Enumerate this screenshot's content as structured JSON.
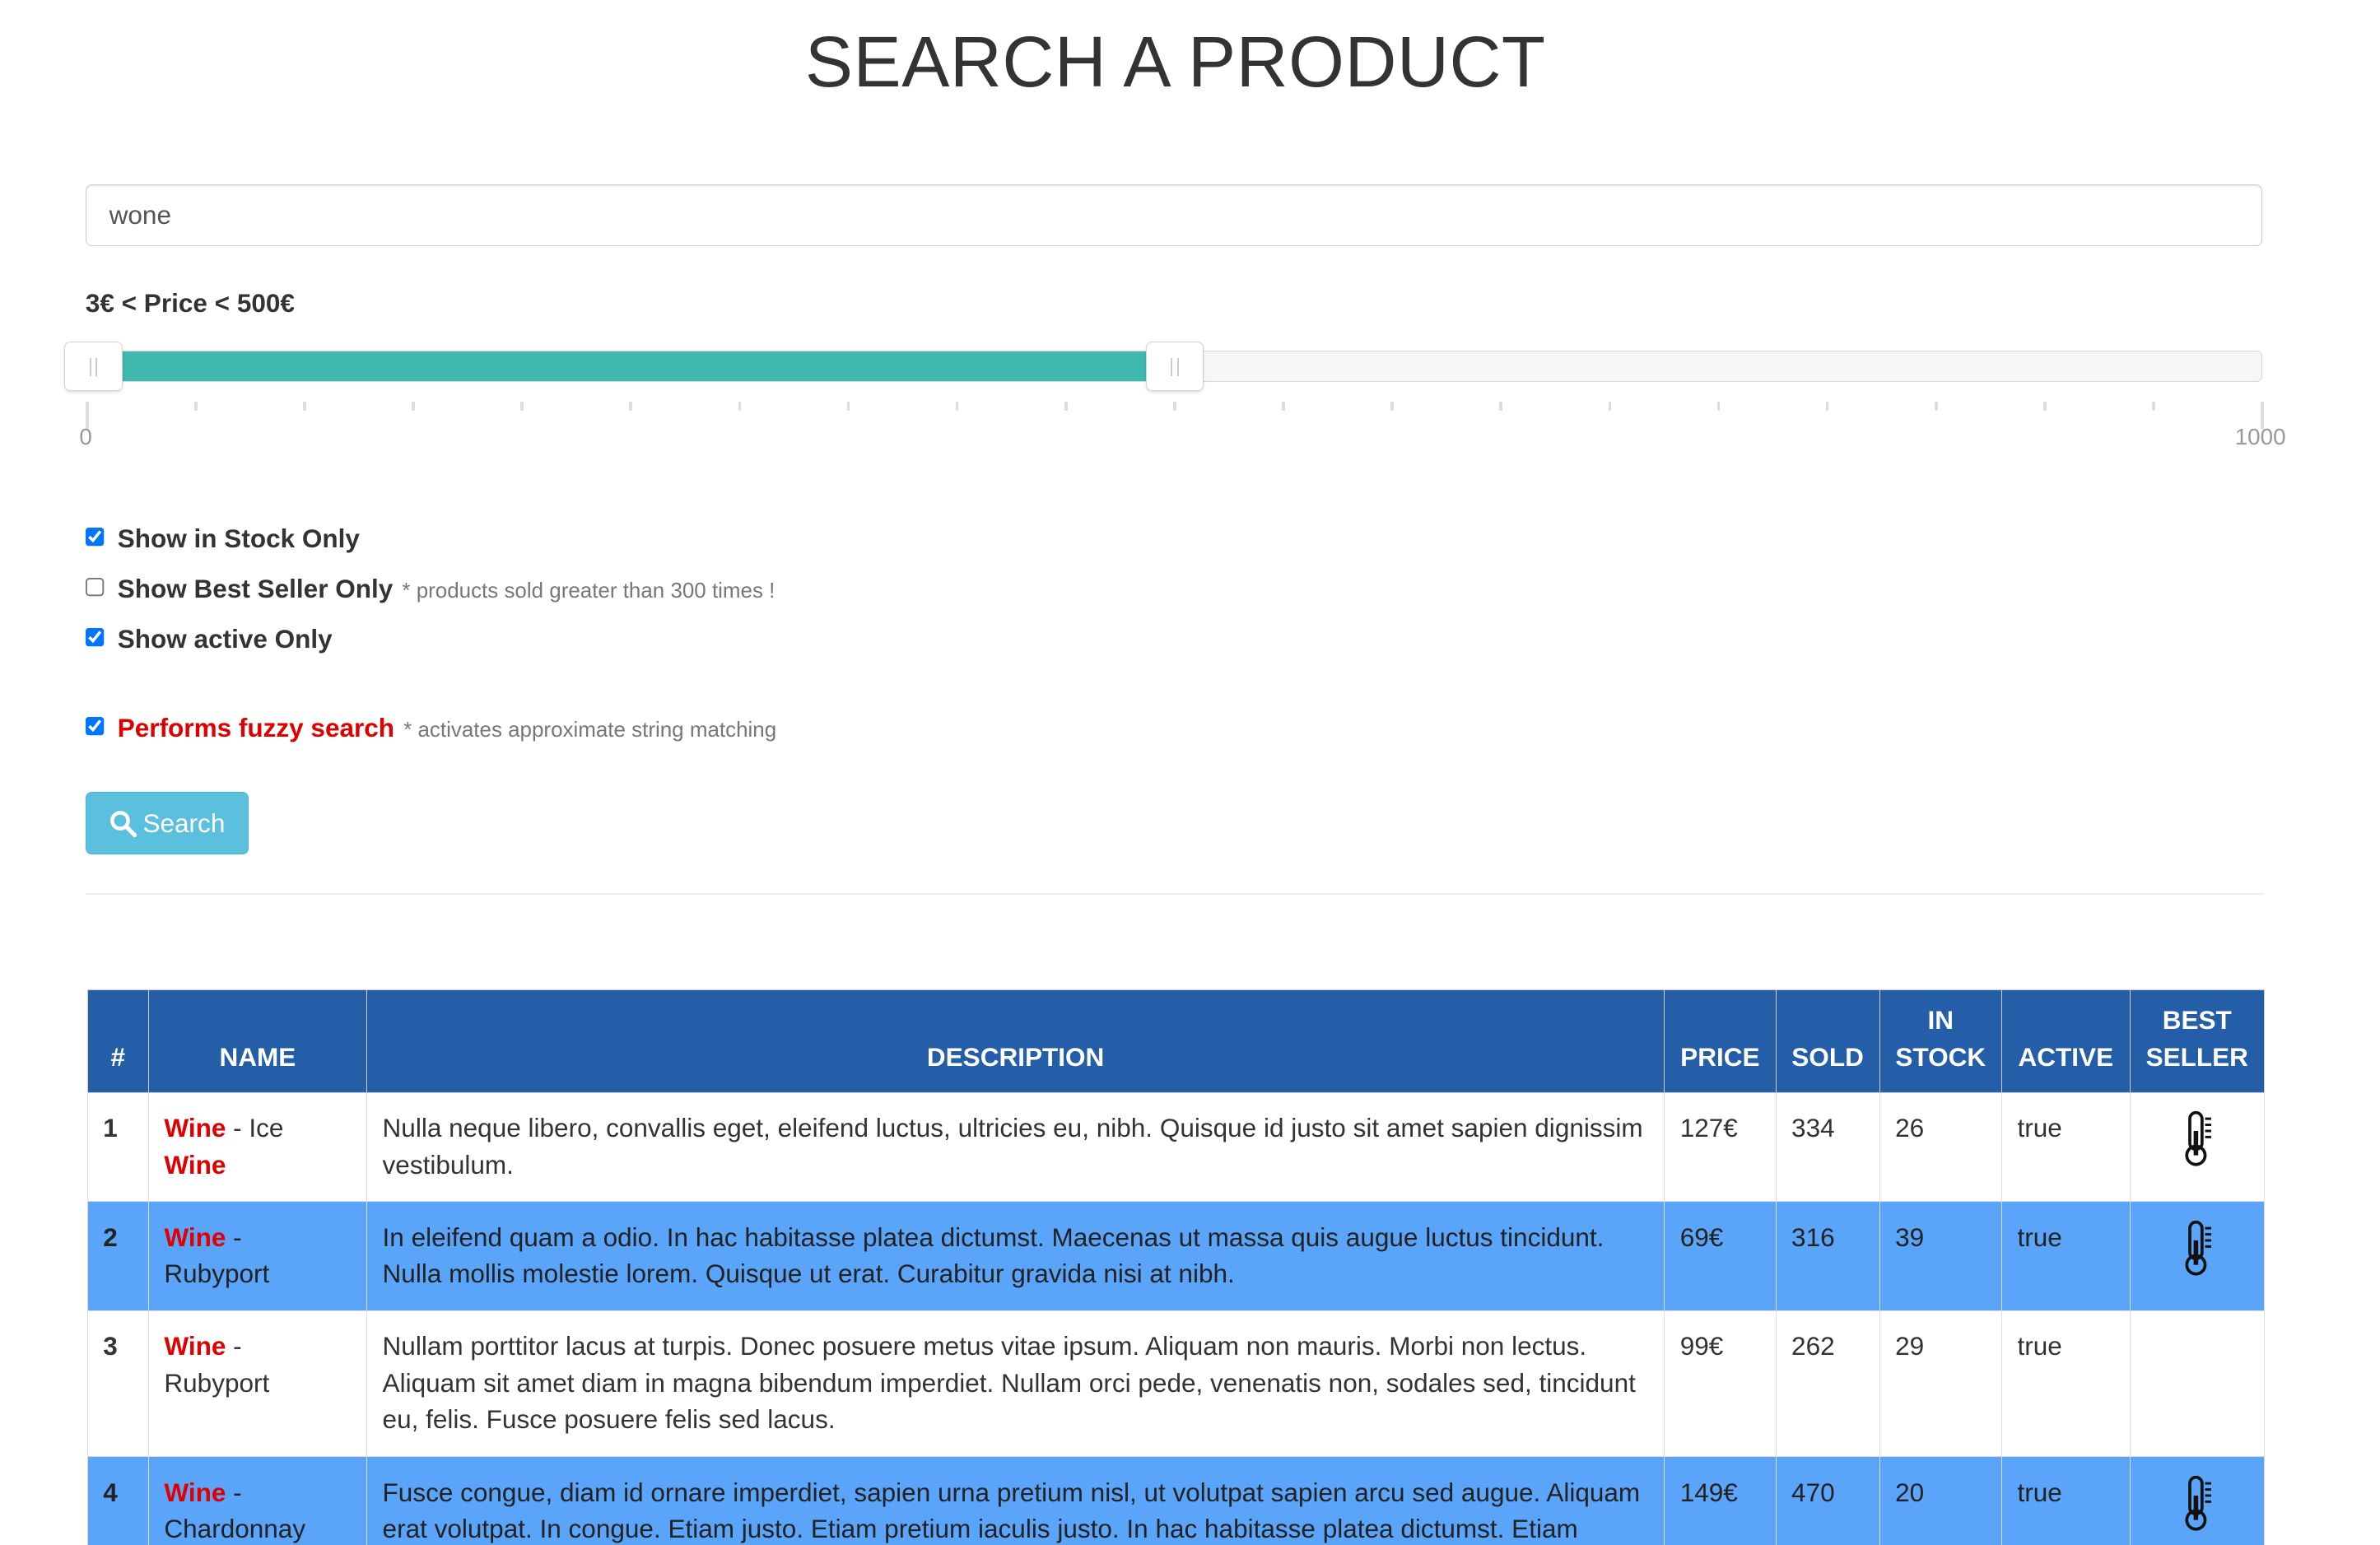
{
  "title": "SEARCH A PRODUCT",
  "search": {
    "value": "wone"
  },
  "price_filter": {
    "label": "3€ < Price < 500€",
    "min": 0,
    "max": 1000,
    "low": 3,
    "high": 500,
    "tick_min_label": "0",
    "tick_max_label": "1000",
    "fill_color": "#3fb8af"
  },
  "filters": [
    {
      "label": "Show in Stock Only",
      "checked": true,
      "hint": ""
    },
    {
      "label": "Show Best Seller Only",
      "checked": false,
      "hint": "* products sold greater than 300 times !"
    },
    {
      "label": "Show active Only",
      "checked": true,
      "hint": ""
    }
  ],
  "fuzzy": {
    "label": "Performs fuzzy search",
    "checked": true,
    "hint": "* activates approximate string matching"
  },
  "search_button": {
    "label": "Search",
    "icon": "search-icon"
  },
  "table": {
    "headers": [
      "#",
      "NAME",
      "DESCRIPTION",
      "PRICE",
      "SOLD",
      "IN STOCK",
      "ACTIVE",
      "BEST SELLER"
    ],
    "rows": [
      {
        "idx": "1",
        "name_key": "Wine",
        "name_sep": " - Ice ",
        "name_rest": "Wine",
        "rest_is_key": true,
        "description": "Nulla neque libero, convallis eget, eleifend luctus, ultricies eu, nibh. Quisque id justo sit amet sapien dignissim vestibulum.",
        "price": "127€",
        "sold": "334",
        "stock": "26",
        "active": "true",
        "best_seller": true
      },
      {
        "idx": "2",
        "name_key": "Wine",
        "name_sep": " - ",
        "name_rest": "Rubyport",
        "rest_is_key": false,
        "description": "In eleifend quam a odio. In hac habitasse platea dictumst. Maecenas ut massa quis augue luctus tincidunt. Nulla mollis molestie lorem. Quisque ut erat. Curabitur gravida nisi at nibh.",
        "price": "69€",
        "sold": "316",
        "stock": "39",
        "active": "true",
        "best_seller": true
      },
      {
        "idx": "3",
        "name_key": "Wine",
        "name_sep": " - ",
        "name_rest": "Rubyport",
        "rest_is_key": false,
        "description": "Nullam porttitor lacus at turpis. Donec posuere metus vitae ipsum. Aliquam non mauris. Morbi non lectus. Aliquam sit amet diam in magna bibendum imperdiet. Nullam orci pede, venenatis non, sodales sed, tincidunt eu, felis. Fusce posuere felis sed lacus.",
        "price": "99€",
        "sold": "262",
        "stock": "29",
        "active": "true",
        "best_seller": false
      },
      {
        "idx": "4",
        "name_key": "Wine",
        "name_sep": " - ",
        "name_rest": "Chardonnay",
        "rest_is_key": false,
        "description": "Fusce congue, diam id ornare imperdiet, sapien urna pretium nisl, ut volutpat sapien arcu sed augue. Aliquam erat volutpat. In congue. Etiam justo. Etiam pretium iaculis justo. In hac habitasse platea dictumst. Etiam",
        "price": "149€",
        "sold": "470",
        "stock": "20",
        "active": "true",
        "best_seller": true
      }
    ]
  }
}
